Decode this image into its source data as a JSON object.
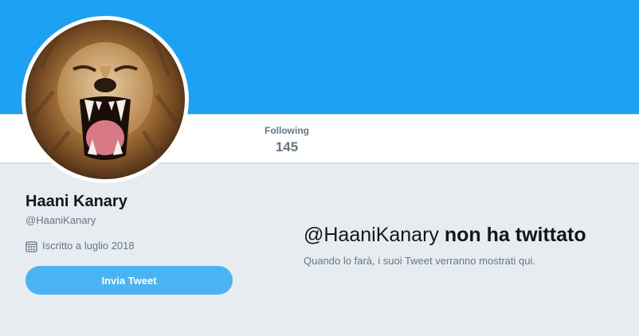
{
  "profile": {
    "name": "Haani Kanary",
    "handle": "@HaaniKanary",
    "joined": "Iscritto a luglio 2018"
  },
  "stats": {
    "following_label": "Following",
    "following_value": "145"
  },
  "actions": {
    "tweet_button_label": "Invia Tweet"
  },
  "empty_state": {
    "handle": "@HaaniKanary",
    "message": "non ha twittato",
    "subtitle": "Quando lo farà, i suoi Tweet verranno mostrati qui."
  },
  "colors": {
    "banner": "#1da1f2",
    "page_background": "#e6ecf0",
    "button": "#4ab3f4",
    "secondary_text": "#657786"
  },
  "icons": {
    "joined": "calendar-icon"
  }
}
